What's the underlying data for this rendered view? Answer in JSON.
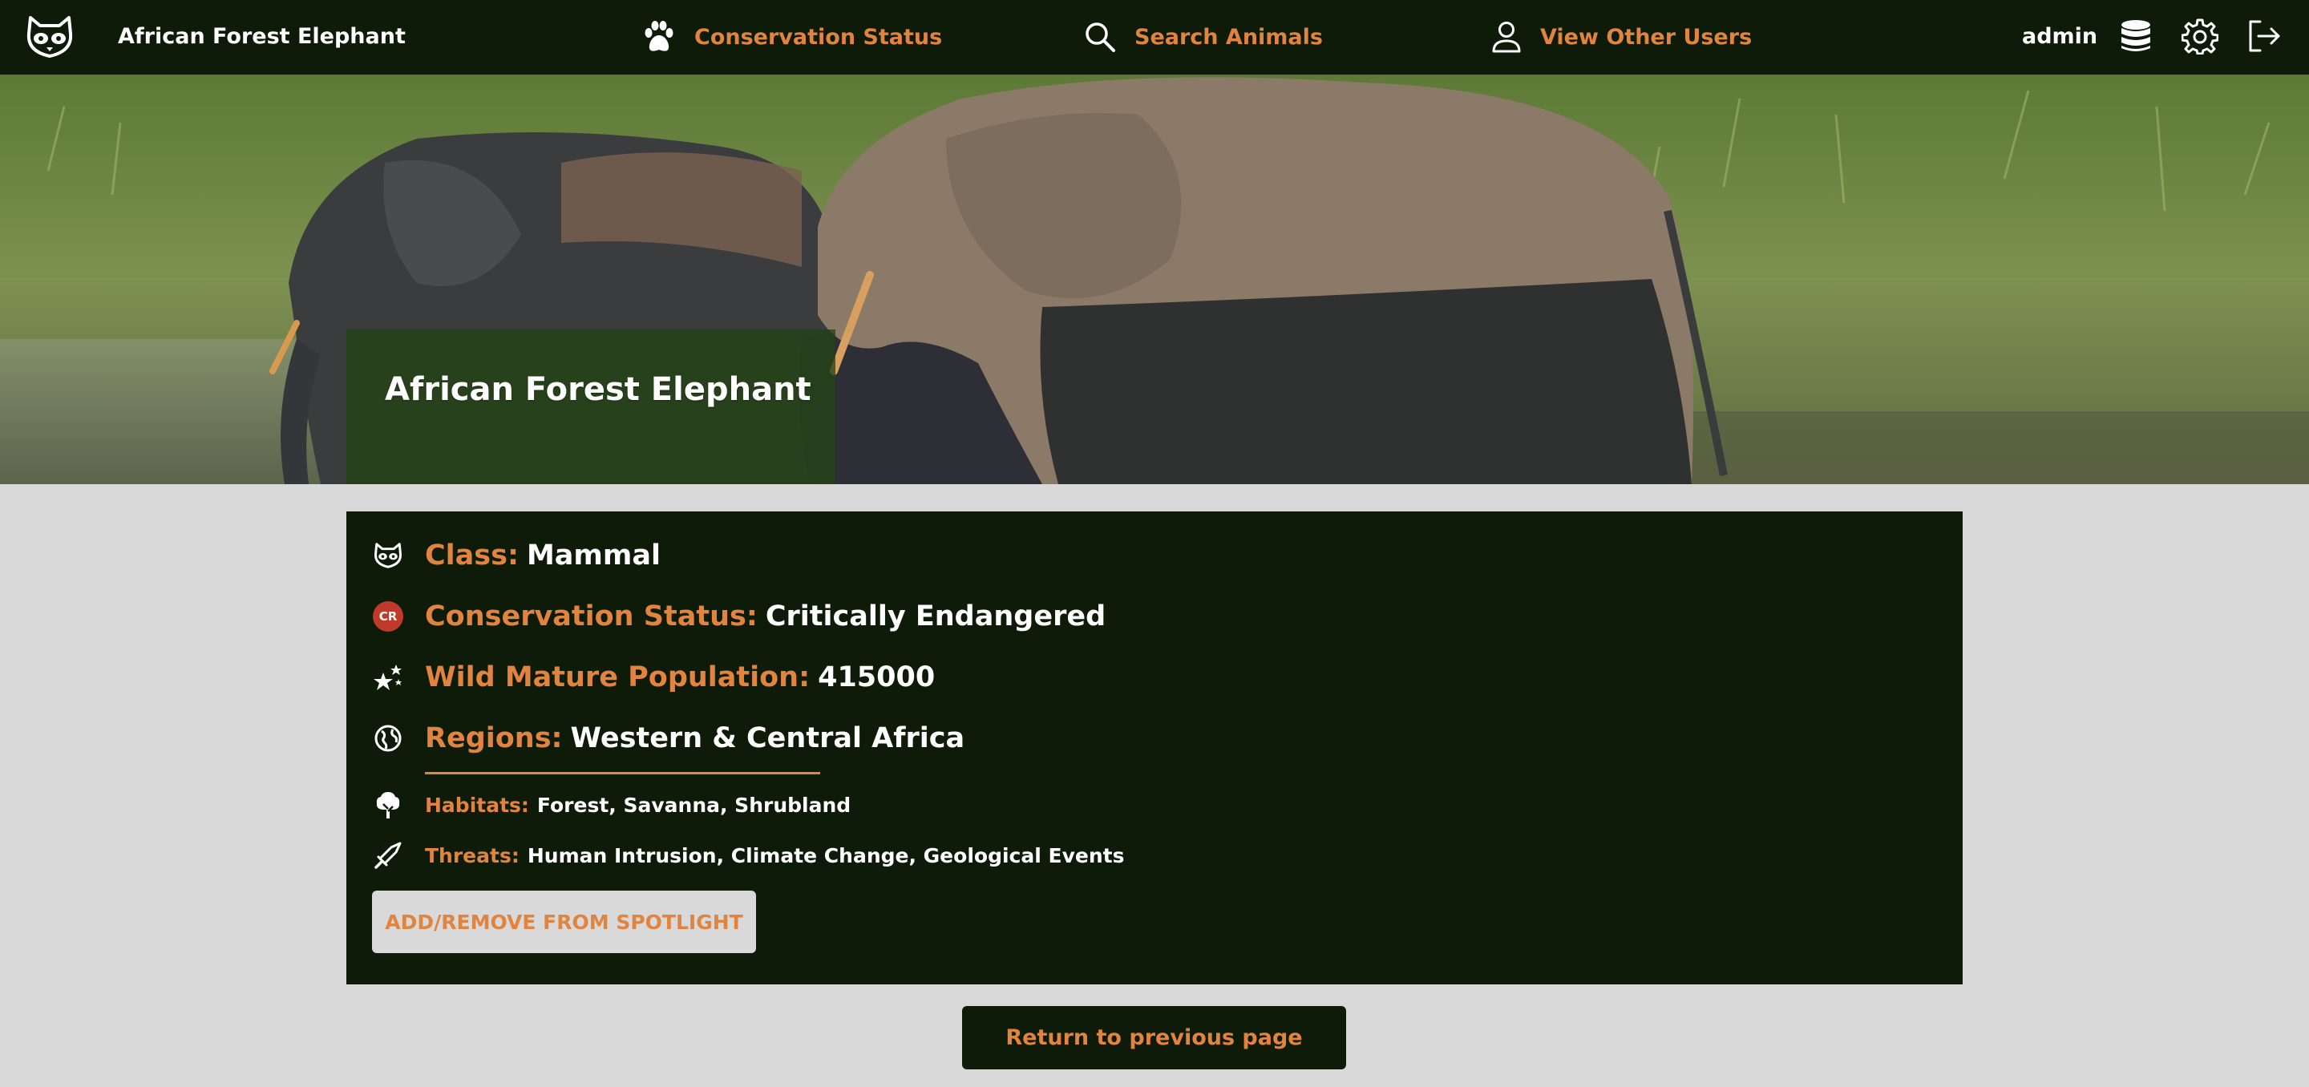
{
  "nav": {
    "brand": "African Forest Elephant",
    "conservation_status": "Conservation Status",
    "search_animals": "Search Animals",
    "view_other_users": "View Other Users",
    "username": "admin"
  },
  "hero": {
    "title": "African Forest Elephant"
  },
  "details": {
    "class_label": "Class:",
    "class_value": "Mammal",
    "status_badge": "CR",
    "status_label": "Conservation Status:",
    "status_value": "Critically Endangered",
    "population_label": "Wild Mature Population:",
    "population_value": "415000",
    "regions_label": "Regions:",
    "regions_value": "Western & Central Africa",
    "habitats_label": "Habitats:",
    "habitats_value": "Forest, Savanna, Shrubland",
    "threats_label": "Threats:",
    "threats_value": "Human Intrusion, Climate Change, Geological Events"
  },
  "actions": {
    "spotlight": "ADD/REMOVE FROM SPOTLIGHT",
    "return": "Return to previous page"
  },
  "colors": {
    "dark_green": "#0e1b08",
    "accent_orange": "#e0843f",
    "page_bg": "#d9d9d9",
    "cr_red": "#c0392b"
  },
  "icons": [
    "raccoon-logo-icon",
    "paw-icon",
    "search-icon",
    "user-icon",
    "database-icon",
    "gear-icon",
    "logout-icon",
    "globe-icon",
    "stars-icon",
    "tree-icon",
    "sword-icon"
  ]
}
